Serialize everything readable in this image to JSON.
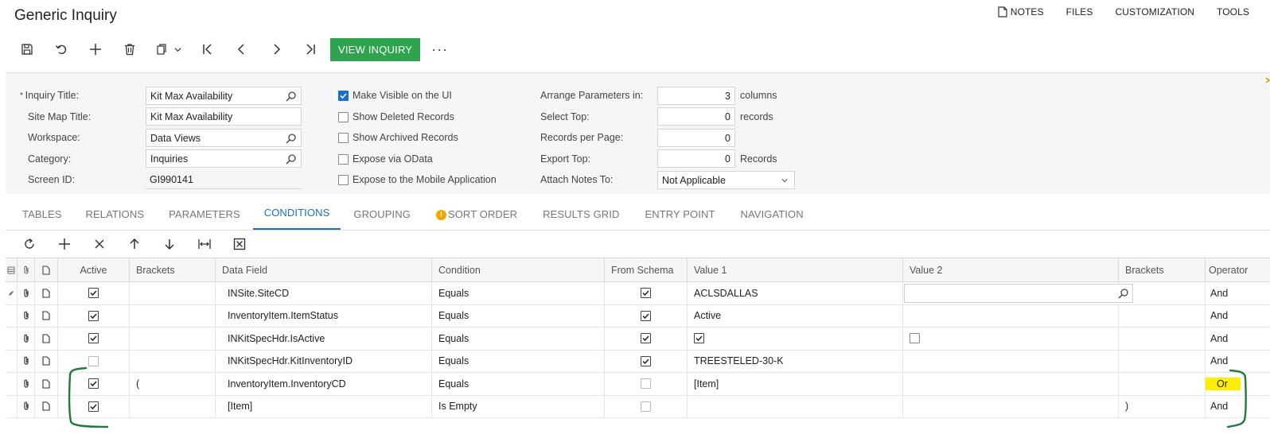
{
  "page": {
    "title": "Generic Inquiry"
  },
  "top_links": [
    {
      "label": "NOTES",
      "icon": "note-icon"
    },
    {
      "label": "FILES"
    },
    {
      "label": "CUSTOMIZATION"
    },
    {
      "label": "TOOLS"
    }
  ],
  "toolbar": {
    "icons": [
      "save-icon",
      "undo-icon",
      "add-icon",
      "delete-icon",
      "copy-paste-icon",
      "first-icon",
      "prev-icon",
      "next-icon",
      "last-icon"
    ],
    "view_inquiry": "VIEW INQUIRY",
    "more": "···",
    "accent": "#2ea44f"
  },
  "form": {
    "inquiry_title_label": "Inquiry Title:",
    "inquiry_title_value": "Kit Max Availability",
    "site_map_title_label": "Site Map Title:",
    "site_map_title_value": "Kit Max Availability",
    "workspace_label": "Workspace:",
    "workspace_value": "Data Views",
    "category_label": "Category:",
    "category_value": "Inquiries",
    "screen_id_label": "Screen ID:",
    "screen_id_value": "GI990141",
    "make_visible": {
      "label": "Make Visible on the UI",
      "checked": true
    },
    "show_deleted": {
      "label": "Show Deleted Records",
      "checked": false
    },
    "show_archived": {
      "label": "Show Archived Records",
      "checked": false
    },
    "expose_odata": {
      "label": "Expose via OData",
      "checked": false
    },
    "expose_mobile": {
      "label": "Expose to the Mobile Application",
      "checked": false
    },
    "arrange_label": "Arrange Parameters in:",
    "arrange_value": "3",
    "arrange_unit": "columns",
    "select_top_label": "Select Top:",
    "select_top_value": "0",
    "select_top_unit": "records",
    "records_per_page_label": "Records per Page:",
    "records_per_page_value": "0",
    "export_top_label": "Export Top:",
    "export_top_value": "0",
    "export_top_unit": "Records",
    "attach_notes_label": "Attach Notes To:",
    "attach_notes_value": "Not Applicable"
  },
  "tabs": [
    {
      "label": "TABLES"
    },
    {
      "label": "RELATIONS"
    },
    {
      "label": "PARAMETERS"
    },
    {
      "label": "CONDITIONS",
      "active": true
    },
    {
      "label": "GROUPING"
    },
    {
      "label": "SORT ORDER",
      "warning": true
    },
    {
      "label": "RESULTS GRID"
    },
    {
      "label": "ENTRY POINT"
    },
    {
      "label": "NAVIGATION"
    }
  ],
  "grid_toolbar_icons": [
    "refresh-icon",
    "add-row-icon",
    "delete-row-icon",
    "move-up-icon",
    "move-down-icon",
    "fit-columns-icon",
    "export-excel-icon"
  ],
  "grid": {
    "columns": [
      "Active",
      "Brackets",
      "Data Field",
      "Condition",
      "From Schema",
      "Value 1",
      "Value 2",
      "Brackets",
      "Operator"
    ],
    "rows": [
      {
        "active": true,
        "open_bracket": "",
        "data_field": "INSite.SiteCD",
        "condition": "Equals",
        "from_schema": true,
        "value1": "ACLSDALLAS",
        "value2": "",
        "close_bracket": "",
        "operator": "And",
        "editing": true
      },
      {
        "active": true,
        "open_bracket": "",
        "data_field": "InventoryItem.ItemStatus",
        "condition": "Equals",
        "from_schema": true,
        "value1": "Active",
        "value2": "",
        "close_bracket": "",
        "operator": "And"
      },
      {
        "active": true,
        "open_bracket": "",
        "data_field": "INKitSpecHdr.IsActive",
        "condition": "Equals",
        "from_schema": true,
        "value1": "",
        "value1_checkbox": true,
        "value2_checkbox": false,
        "close_bracket": "",
        "operator": "And"
      },
      {
        "active": false,
        "open_bracket": "",
        "data_field": "INKitSpecHdr.KitInventoryID",
        "condition": "Equals",
        "from_schema": true,
        "value1": "TREESTELED-30-K",
        "value2": "",
        "close_bracket": "",
        "operator": "And"
      },
      {
        "active": true,
        "open_bracket": "(",
        "data_field": "InventoryItem.InventoryCD",
        "condition": "Equals",
        "from_schema": false,
        "value1": "[Item]",
        "value2": "",
        "close_bracket": "",
        "operator": "Or",
        "highlight": "#ffee00"
      },
      {
        "active": true,
        "open_bracket": "",
        "data_field": "[Item]",
        "condition": "Is Empty",
        "from_schema": false,
        "value1": "",
        "value2": "",
        "close_bracket": ")",
        "operator": "And"
      }
    ]
  },
  "annotation_color": "#1f7a3c"
}
